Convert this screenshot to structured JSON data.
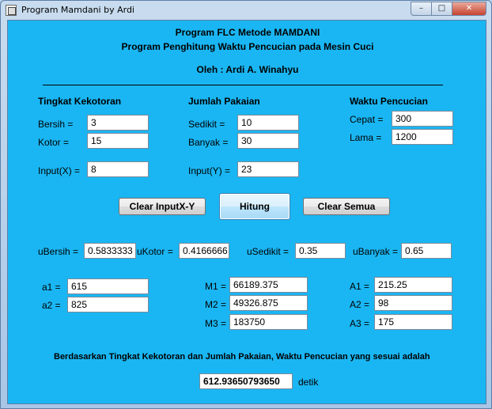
{
  "window": {
    "title": "Program Mamdani by Ardi",
    "minimize_glyph": "–",
    "maximize_glyph": "□",
    "close_glyph": "✕"
  },
  "header": {
    "line1": "Program FLC Metode MAMDANI",
    "line2": "Program Penghitung Waktu Pencucian pada Mesin Cuci",
    "author": "Oleh : Ardi A. Winahyu"
  },
  "kekotoran": {
    "title": "Tingkat Kekotoran",
    "bersih_label": "Bersih =",
    "bersih_value": "3",
    "kotor_label": "Kotor =",
    "kotor_value": "15",
    "input_label": "Input(X) =",
    "input_value": "8"
  },
  "pakaian": {
    "title": "Jumlah Pakaian",
    "sedikit_label": "Sedikit =",
    "sedikit_value": "10",
    "banyak_label": "Banyak =",
    "banyak_value": "30",
    "input_label": "Input(Y) =",
    "input_value": "23"
  },
  "pencucian": {
    "title": "Waktu Pencucian",
    "cepat_label": "Cepat =",
    "cepat_value": "300",
    "lama_label": "Lama =",
    "lama_value": "1200"
  },
  "buttons": {
    "clear_xy": "Clear InputX-Y",
    "hitung": "Hitung",
    "clear_all": "Clear Semua"
  },
  "membership": {
    "ubersih_label": "uBersih =",
    "ubersih_value": "0.5833333",
    "ukotor_label": "uKotor =",
    "ukotor_value": "0.4166666",
    "usedikit_label": "uSedikit =",
    "usedikit_value": "0.35",
    "ubanyak_label": "uBanyak =",
    "ubanyak_value": "0.65"
  },
  "alpha": {
    "a1_label": "a1 =",
    "a1_value": "615",
    "a2_label": "a2 =",
    "a2_value": "825"
  },
  "moments": {
    "m1_label": "M1 =",
    "m1_value": "66189.375",
    "m2_label": "M2 =",
    "m2_value": "49326.875",
    "m3_label": "M3 =",
    "m3_value": "183750"
  },
  "areas": {
    "a1_label": "A1 =",
    "a1_value": "215.25",
    "a2_label": "A2 =",
    "a2_value": "98",
    "a3_label": "A3 =",
    "a3_value": "175"
  },
  "result": {
    "sentence": "Berdasarkan Tingkat Kekotoran dan Jumlah Pakaian, Waktu Pencucian yang sesuai adalah",
    "value": "612.93650793650",
    "unit": "detik"
  }
}
